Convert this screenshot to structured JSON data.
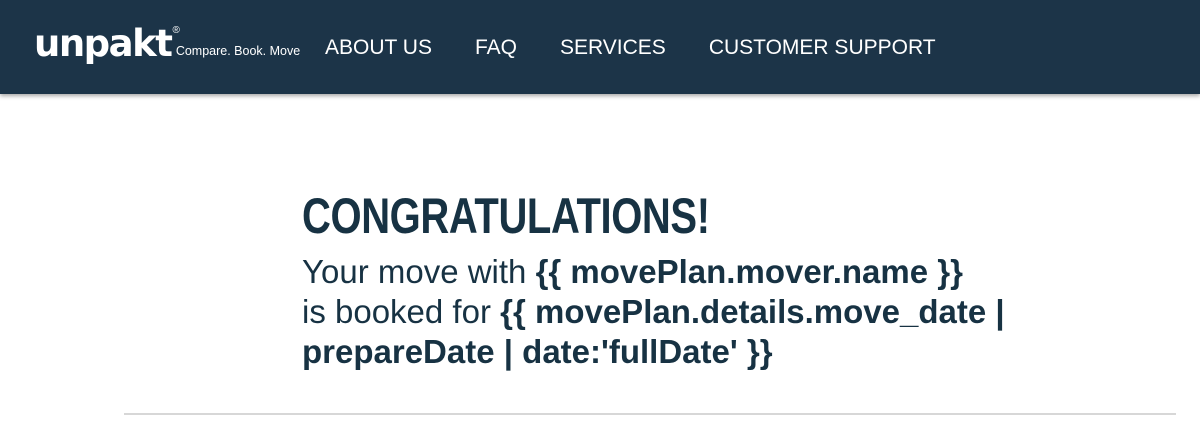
{
  "header": {
    "logo": {
      "text": "unpakt",
      "registered_mark": "®",
      "tagline": "Compare. Book. Move"
    },
    "nav": {
      "about": "ABOUT US",
      "faq": "FAQ",
      "services": "SERVICES",
      "support": "CUSTOMER SUPPORT"
    },
    "colors": {
      "background": "#1c3448",
      "text": "#ffffff"
    }
  },
  "main": {
    "heading": "CONGRATULATIONS!",
    "message": {
      "line1_prefix": "Your move with ",
      "line1_bold": "{{ movePlan.mover.name }}",
      "line2_prefix": "is booked for ",
      "line2_bold": "{{ movePlan.details.move_date |",
      "line3_bold": "prepareDate | date:'fullDate' }}"
    },
    "colors": {
      "text": "#173243",
      "divider": "#d7d7d7"
    }
  }
}
